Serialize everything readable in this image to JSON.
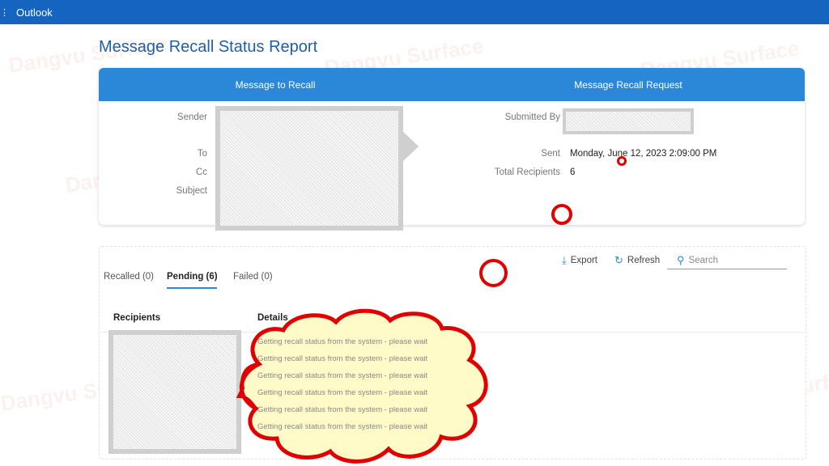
{
  "app": {
    "name": "Outlook"
  },
  "page": {
    "title": "Message Recall Status Report"
  },
  "summary": {
    "left_header": "Message to Recall",
    "right_header": "Message Recall Request",
    "labels": {
      "sender": "Sender",
      "to": "To",
      "cc": "Cc",
      "subject": "Subject",
      "submitted_by": "Submitted By",
      "sent": "Sent",
      "total_recipients": "Total Recipients"
    },
    "sent_value": "Monday, June 12, 2023 2:09:00 PM",
    "total_recipients_value": "6"
  },
  "tabs": [
    {
      "label": "Recalled (0)"
    },
    {
      "label": "Pending (6)",
      "active": true
    },
    {
      "label": "Failed (0)"
    }
  ],
  "toolbar": {
    "export": "Export",
    "refresh": "Refresh",
    "search_placeholder": "Search"
  },
  "table": {
    "columns": [
      "Recipients",
      "Details"
    ],
    "details": [
      "Getting recall status from the system - please wait",
      "Getting recall status from the system - please wait",
      "Getting recall status from the system - please wait",
      "Getting recall status from the system - please wait",
      "Getting recall status from the system - please wait",
      "Getting recall status from the system - please wait"
    ]
  },
  "watermark": "Dangvu Surface",
  "colors": {
    "topbar": "#1565c0",
    "header": "#2b88d8",
    "title": "#1f5fa8",
    "annotation": "#e00000",
    "cloud_fill": "#fffbc8"
  }
}
